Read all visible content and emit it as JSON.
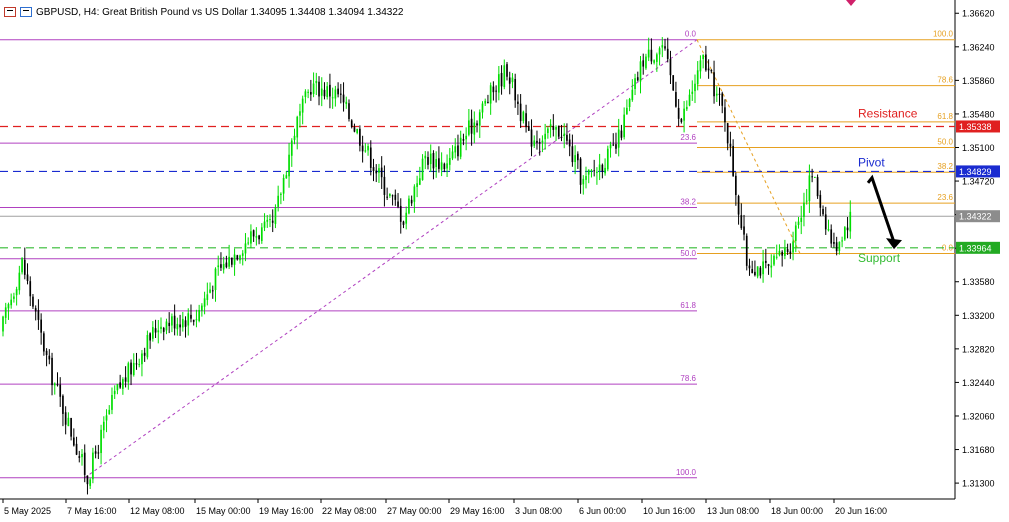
{
  "header": {
    "symbol_text": "GBPUSD, H4:  Great British Pound vs US Dollar  1.34095 1.34408 1.34094 1.34322",
    "icons": [
      "chart-window-icon",
      "chart-settings-icon"
    ]
  },
  "colors": {
    "bull": "#00dd00",
    "bear": "#000000",
    "resistance": "#e02020",
    "pivot": "#1a2bd0",
    "support": "#33bb33",
    "fib_retr": "#b040c0",
    "fib_exp": "#e6a020",
    "current_price_bg": "#8c8c8c",
    "resistance_bg": "#e02020",
    "pivot_bg": "#1a2bd0",
    "support_bg": "#22aa22"
  },
  "chart_data": {
    "type": "candlestick",
    "symbol": "GBPUSD",
    "timeframe": "H4",
    "ylim": [
      1.3112,
      1.3677
    ],
    "y_ticks": [
      1.3662,
      1.3624,
      1.3586,
      1.3548,
      1.351,
      1.3472,
      1.3434,
      1.3396,
      1.3358,
      1.332,
      1.3282,
      1.3244,
      1.3206,
      1.3168,
      1.313
    ],
    "y_tick_labels": [
      "1.36620",
      "1.36240",
      "1.35860",
      "1.35480",
      "1.35100",
      "1.34720",
      "1.34340",
      "1.33960",
      "1.33580",
      "1.33200",
      "1.32820",
      "1.32440",
      "1.32060",
      "1.31680",
      "1.31300"
    ],
    "x_labels": [
      "5 May 2025",
      "7 May 16:00",
      "12 May 08:00",
      "15 May 00:00",
      "19 May 16:00",
      "22 May 08:00",
      "27 May 00:00",
      "29 May 16:00",
      "3 Jun 08:00",
      "6 Jun 00:00",
      "10 Jun 16:00",
      "13 Jun 08:00",
      "18 Jun 00:00",
      "20 Jun 16:00"
    ],
    "anchors": [
      [
        0,
        1.33
      ],
      [
        8,
        1.338
      ],
      [
        18,
        1.326
      ],
      [
        32,
        1.3135
      ],
      [
        42,
        1.323
      ],
      [
        58,
        1.331
      ],
      [
        72,
        1.332
      ],
      [
        80,
        1.337
      ],
      [
        92,
        1.341
      ],
      [
        100,
        1.342
      ],
      [
        108,
        1.353
      ],
      [
        114,
        1.358
      ],
      [
        124,
        1.357
      ],
      [
        134,
        1.351
      ],
      [
        142,
        1.346
      ],
      [
        148,
        1.343
      ],
      [
        156,
        1.35
      ],
      [
        164,
        1.349
      ],
      [
        176,
        1.355
      ],
      [
        186,
        1.36
      ],
      [
        194,
        1.352
      ],
      [
        206,
        1.353
      ],
      [
        214,
        1.347
      ],
      [
        226,
        1.351
      ],
      [
        236,
        1.361
      ],
      [
        243,
        1.3625
      ],
      [
        250,
        1.354
      ],
      [
        258,
        1.361
      ],
      [
        266,
        1.3545
      ],
      [
        274,
        1.338
      ],
      [
        282,
        1.337
      ],
      [
        290,
        1.34
      ],
      [
        298,
        1.348
      ],
      [
        306,
        1.3395
      ],
      [
        312,
        1.3432
      ]
    ],
    "levels": [
      {
        "name": "Resistance",
        "price": 1.35338,
        "label": "1.35338"
      },
      {
        "name": "Pivot",
        "price": 1.34829,
        "label": "1.34829"
      },
      {
        "name": "Support",
        "price": 1.33964,
        "label": "1.33964"
      }
    ],
    "current_price": {
      "price": 1.34322,
      "label": "1.34322"
    },
    "fib_retracement": {
      "from": 1.3136,
      "to": 1.3632,
      "levels": [
        {
          "label": "0.0",
          "price": 1.3632
        },
        {
          "label": "23.6",
          "price": 1.3515
        },
        {
          "label": "38.2",
          "price": 1.3442
        },
        {
          "label": "50.0",
          "price": 1.3384
        },
        {
          "label": "61.8",
          "price": 1.3325
        },
        {
          "label": "78.6",
          "price": 1.3242
        },
        {
          "label": "100.0",
          "price": 1.3136
        }
      ]
    },
    "fib_expansion": {
      "from": 1.3632,
      "to": 1.339,
      "levels": [
        {
          "label": "100.0",
          "price": 1.3632
        },
        {
          "label": "78.6",
          "price": 1.358
        },
        {
          "label": "61.8",
          "price": 1.3539
        },
        {
          "label": "50.0",
          "price": 1.351
        },
        {
          "label": "38.2",
          "price": 1.3482
        },
        {
          "label": "23.6",
          "price": 1.3447
        },
        {
          "label": "0.0",
          "price": 1.339
        }
      ]
    },
    "annotations": [
      {
        "text": "Resistance",
        "price": 1.35338
      },
      {
        "text": "Pivot",
        "price": 1.34829
      },
      {
        "text": "Support",
        "price": 1.33964
      }
    ],
    "arrow": {
      "from_price": 1.3478,
      "to_price": 1.3396
    }
  }
}
